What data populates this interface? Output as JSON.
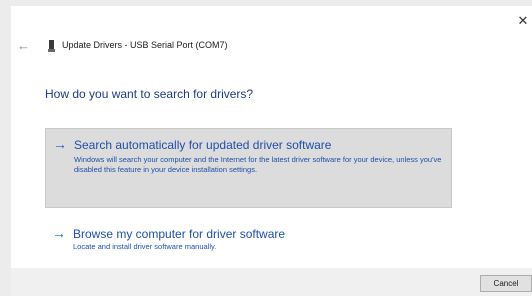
{
  "window": {
    "close_glyph": "✕",
    "back_glyph": "←",
    "title": "Update Drivers - USB Serial Port (COM7)",
    "device_icon": "usb-device-icon"
  },
  "main": {
    "heading": "How do you want to search for drivers?",
    "options": [
      {
        "arrow": "→",
        "title": "Search automatically for updated driver software",
        "description": "Windows will search your computer and the Internet for the latest driver software for your device, unless you've disabled this feature in your device installation settings.",
        "selected": true
      },
      {
        "arrow": "→",
        "title": "Browse my computer for driver software",
        "description": "Locate and install driver software manually.",
        "selected": false
      }
    ]
  },
  "footer": {
    "cancel_label": "Cancel"
  },
  "colors": {
    "accent": "#1f4fa8",
    "heading": "#1a3a8a",
    "selected_bg": "#dcdcdc"
  }
}
